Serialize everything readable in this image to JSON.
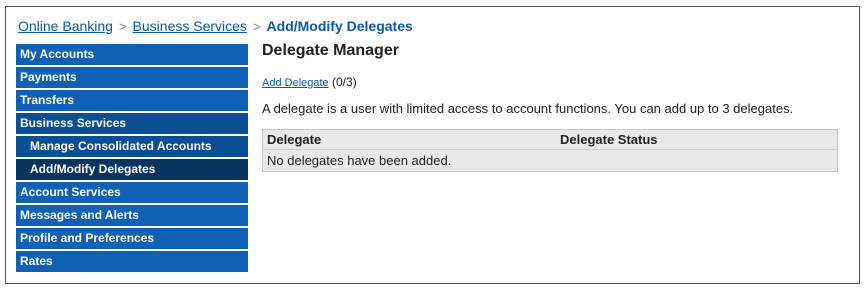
{
  "breadcrumb": {
    "items": [
      "Online Banking",
      "Business Services"
    ],
    "separator": ">",
    "current": "Add/Modify Delegates"
  },
  "sidebar": {
    "items": [
      {
        "label": "My Accounts"
      },
      {
        "label": "Payments"
      },
      {
        "label": "Transfers"
      },
      {
        "label": "Business Services"
      },
      {
        "label": "Manage Consolidated Accounts"
      },
      {
        "label": "Add/Modify Delegates"
      },
      {
        "label": "Account Services"
      },
      {
        "label": "Messages and Alerts"
      },
      {
        "label": "Profile and Preferences"
      },
      {
        "label": "Rates"
      }
    ]
  },
  "main": {
    "title": "Delegate Manager",
    "add_delegate_link": "Add Delegate",
    "delegate_count": "(0/3)",
    "description": "A delegate is a user with limited access to account functions. You can add up to 3 delegates.",
    "table": {
      "columns": [
        "Delegate",
        "Delegate Status"
      ],
      "empty_message": "No delegates have been added."
    }
  },
  "colors": {
    "nav_bg": "#0f61b5",
    "nav_active_bg": "#08355f",
    "link": "#0b5aa8",
    "table_bg": "#e9e9e9"
  }
}
